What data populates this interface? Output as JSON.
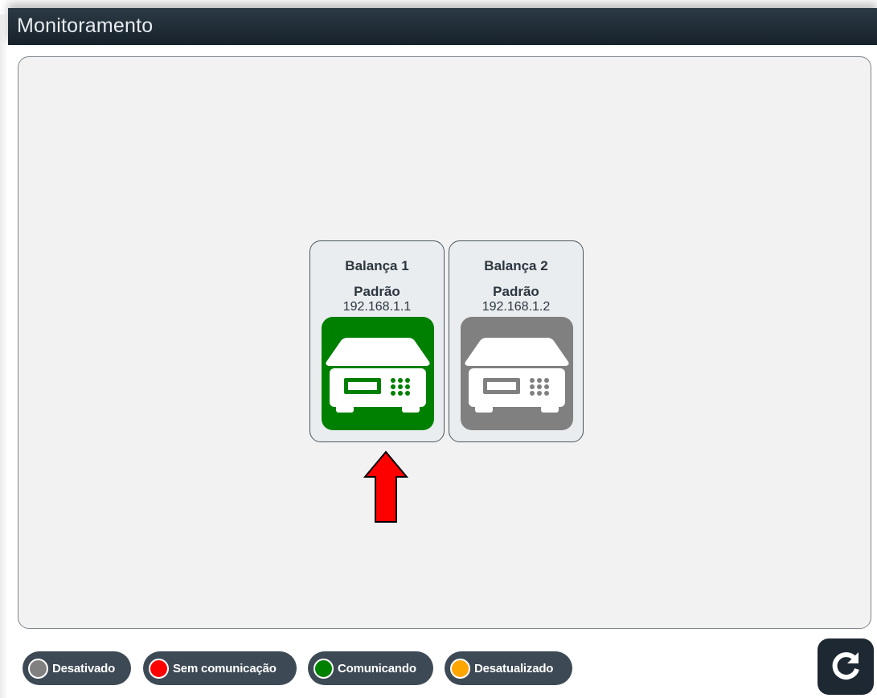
{
  "header": {
    "title": "Monitoramento"
  },
  "devices": [
    {
      "name": "Balança 1",
      "mode": "Padrão",
      "ip": "192.168.1.1",
      "status": "Comunicando",
      "icon": "scale-icon",
      "icon_color": "#008000"
    },
    {
      "name": "Balança 2",
      "mode": "Padrão",
      "ip": "192.168.1.2",
      "status": "Desativado",
      "icon": "scale-icon",
      "icon_color": "#808080"
    }
  ],
  "annotation": {
    "icon": "red-up-arrow",
    "color": "#ff0000"
  },
  "legend": [
    {
      "label": "Desativado",
      "color": "#808080"
    },
    {
      "label": "Sem comunicação",
      "color": "#ff0000"
    },
    {
      "label": "Comunicando",
      "color": "#008000"
    },
    {
      "label": "Desatualizado",
      "color": "#ffa500"
    }
  ],
  "refresh": {
    "icon": "refresh-icon"
  },
  "colors": {
    "header_bg": "#1f2b35",
    "legend_bg": "#3d4a55",
    "panel_bg": "#f2f2f2",
    "card_bg": "#eaedef"
  }
}
